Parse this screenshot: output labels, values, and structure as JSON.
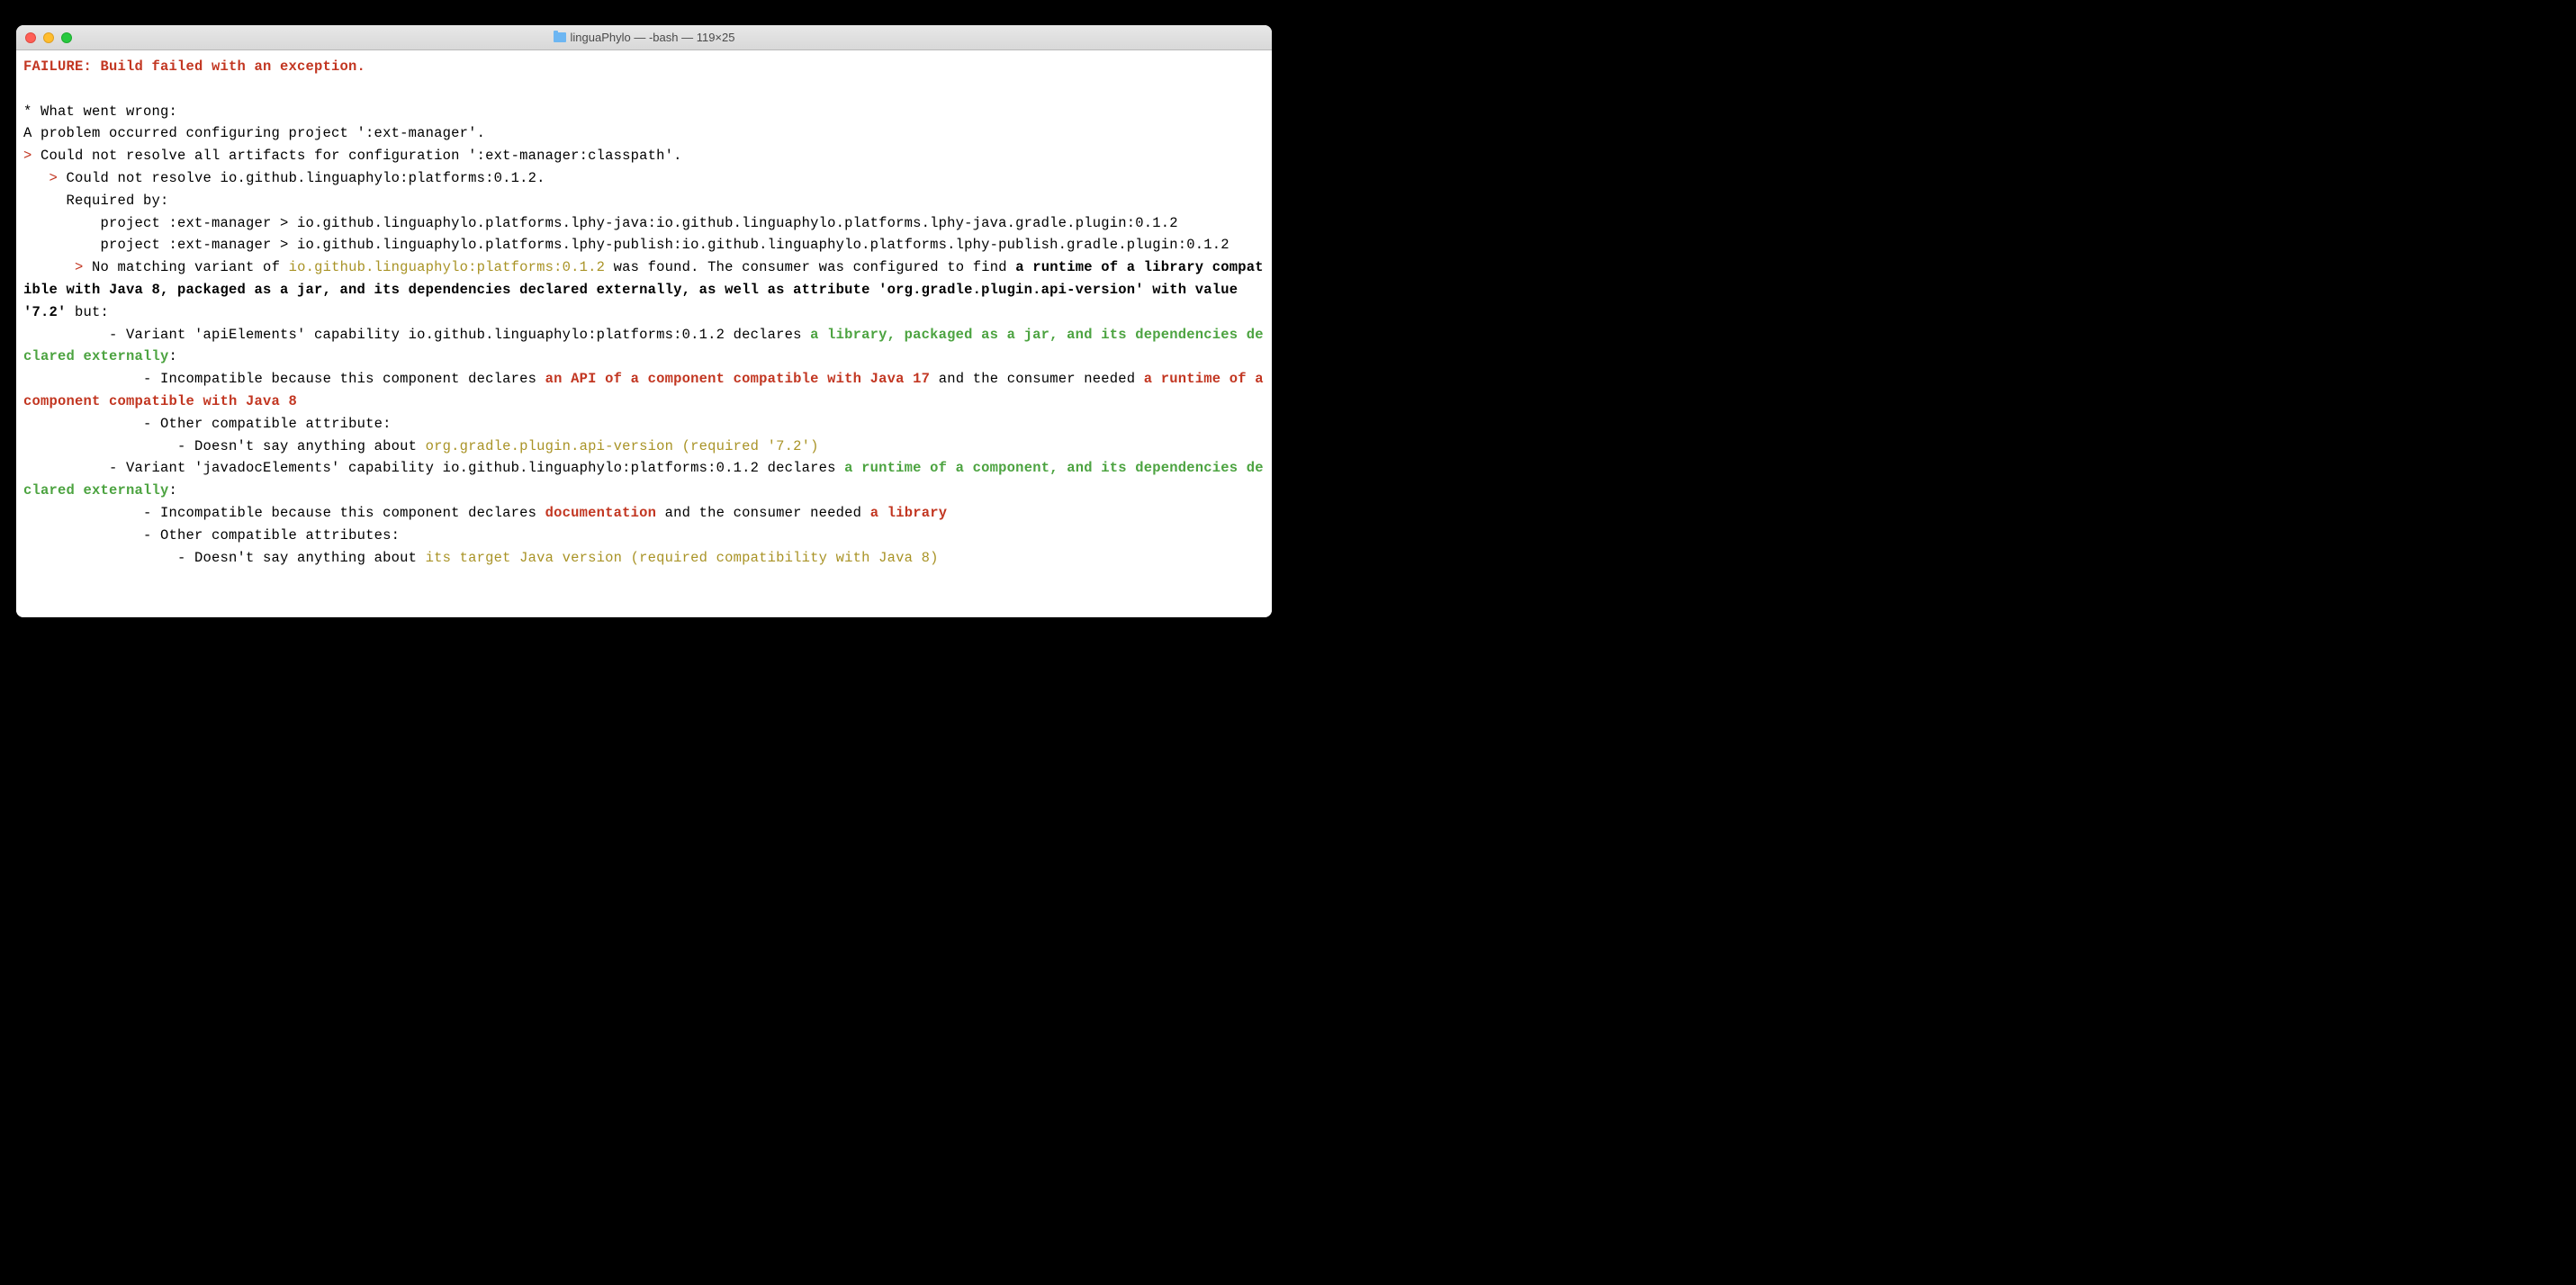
{
  "titlebar": {
    "title": "linguaPhylo — -bash — 119×25"
  },
  "terminal": {
    "l1": "FAILURE: Build failed with an exception.",
    "l2": "",
    "l3": "* What went wrong:",
    "l4": "A problem occurred configuring project ':ext-manager'.",
    "l5a": "> ",
    "l5b": "Could not resolve all artifacts for configuration ':ext-manager:classpath'.",
    "l6a": "   > ",
    "l6b": "Could not resolve io.github.linguaphylo:platforms:0.1.2.",
    "l7": "     Required by:",
    "l8": "         project :ext-manager > io.github.linguaphylo.platforms.lphy-java:io.github.linguaphylo.platforms.lphy-java.gradle.plugin:0.1.2",
    "l9": "         project :ext-manager > io.github.linguaphylo.platforms.lphy-publish:io.github.linguaphylo.platforms.lphy-publish.gradle.plugin:0.1.2",
    "l10a": "      > ",
    "l10b": "No matching variant of ",
    "l10c": "io.github.linguaphylo:platforms:0.1.2",
    "l10d": " was found. The consumer was configured to find ",
    "l10e": "a runtime of a library compatible with Java 8, packaged as a jar, and its dependencies declared externally, as well as attribute 'org.gradle.plugin.api-version' with value '7.2'",
    "l10f": " but:",
    "l11a": "          - Variant 'apiElements' capability io.github.linguaphylo:platforms:0.1.2 declares ",
    "l11b": "a library, packaged as a jar, and its dependencies declared externally",
    "l11c": ":",
    "l12a": "              - Incompatible because this component declares ",
    "l12b": "an API of a component compatible with Java 17",
    "l12c": " and the consumer needed ",
    "l12d": "a runtime of a component compatible with Java 8",
    "l13": "              - Other compatible attribute:",
    "l14a": "                  - Doesn't say anything about ",
    "l14b": "org.gradle.plugin.api-version (required '7.2')",
    "l15a": "          - Variant 'javadocElements' capability io.github.linguaphylo:platforms:0.1.2 declares ",
    "l15b": "a runtime of a component, and its dependencies declared externally",
    "l15c": ":",
    "l16a": "              - Incompatible because this component declares ",
    "l16b": "documentation",
    "l16c": " and the consumer needed ",
    "l16d": "a library",
    "l17": "              - Other compatible attributes:",
    "l18a": "                  - Doesn't say anything about ",
    "l18b": "its target Java version (required compatibility with Java 8)"
  }
}
